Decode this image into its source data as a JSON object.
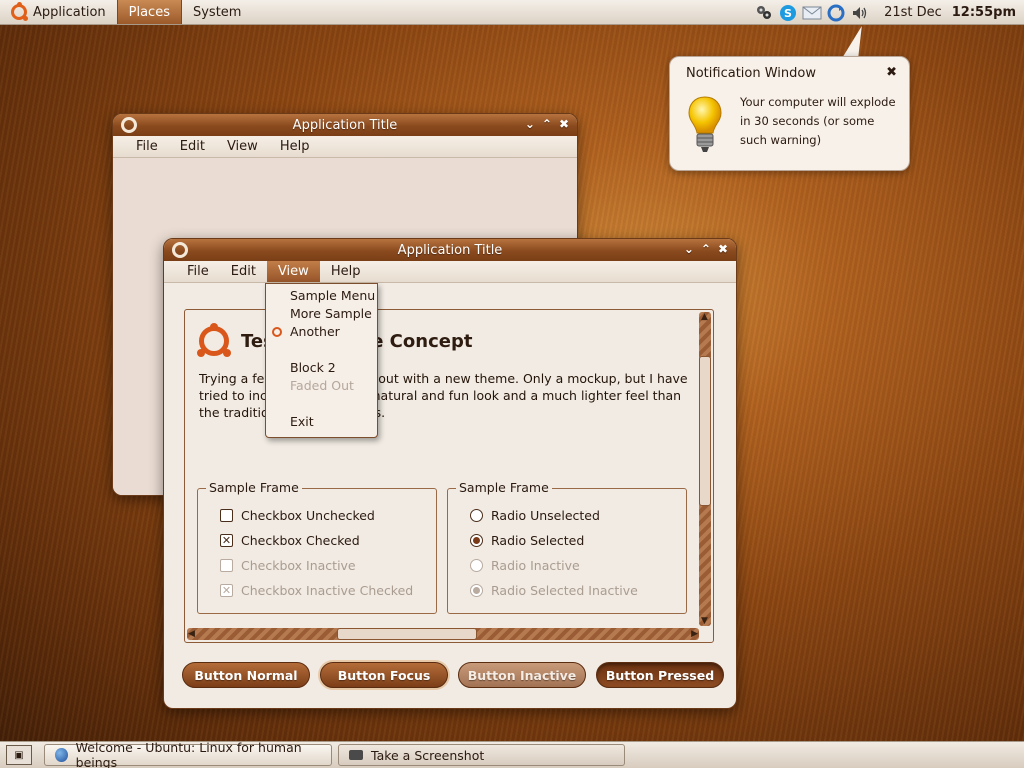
{
  "top_panel": {
    "menus": [
      "Application",
      "Places",
      "System"
    ],
    "active_menu": "Places",
    "date": "21st Dec",
    "time": "12:55pm"
  },
  "back_window": {
    "title": "Application Title",
    "menus": [
      "File",
      "Edit",
      "View",
      "Help"
    ]
  },
  "front_window": {
    "title": "Application Title",
    "menus": [
      "File",
      "Edit",
      "View",
      "Help"
    ],
    "active_menu": "View",
    "heading": "Test of Theme Concept",
    "description": "Trying a few different things out with a new theme.  Only a mockup, but I have tried to incorporate a more natural and fun look and a much lighter feel than the traditional brown themes.",
    "frame_left": {
      "legend": "Sample Frame",
      "options": [
        {
          "label": "Checkbox Unchecked",
          "checked": false,
          "inactive": false
        },
        {
          "label": "Checkbox Checked",
          "checked": true,
          "inactive": false
        },
        {
          "label": "Checkbox Inactive",
          "checked": false,
          "inactive": true
        },
        {
          "label": "Checkbox Inactive Checked",
          "checked": true,
          "inactive": true
        }
      ]
    },
    "frame_right": {
      "legend": "Sample Frame",
      "options": [
        {
          "label": "Radio Unselected",
          "selected": false,
          "inactive": false
        },
        {
          "label": "Radio Selected",
          "selected": true,
          "inactive": false
        },
        {
          "label": "Radio Inactive",
          "selected": false,
          "inactive": true
        },
        {
          "label": "Radio Selected Inactive",
          "selected": true,
          "inactive": true
        }
      ]
    },
    "buttons": [
      "Button Normal",
      "Button Focus",
      "Button Inactive",
      "Button Pressed"
    ]
  },
  "view_dropdown": {
    "items": [
      "Sample Menu",
      "More Sample",
      "Another",
      "Block 2",
      "Faded Out",
      "Exit"
    ]
  },
  "notification": {
    "title": "Notification Window",
    "message": "Your computer will explode in 30 seconds (or some such warning)",
    "close": "✖"
  },
  "taskbar": {
    "tasks": [
      "Welcome - Ubuntu: Linux for human beings",
      "Take a Screenshot"
    ]
  },
  "icons": {
    "tray": [
      "network-icon",
      "skype-icon",
      "mail-icon",
      "update-icon",
      "volume-icon"
    ],
    "notification": "lightbulb-icon"
  },
  "colors": {
    "accent_brown": "#8a4a1e",
    "ubuntu_orange": "#d9571a",
    "panel_bg": "#f2ebe4"
  }
}
